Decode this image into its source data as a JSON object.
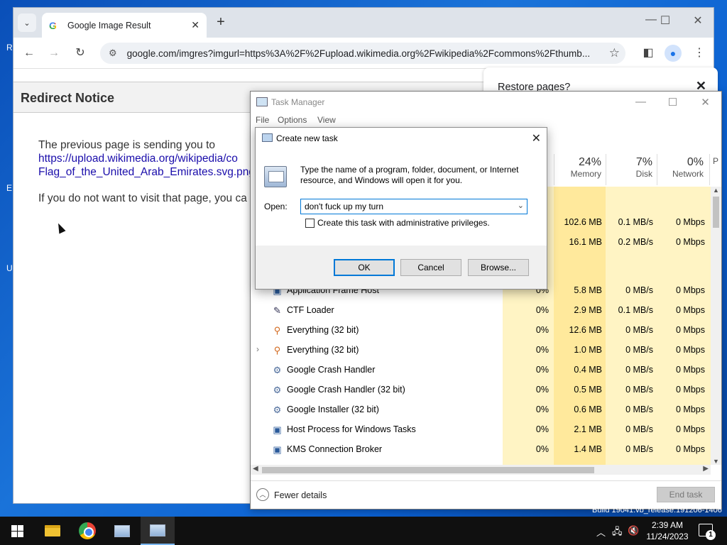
{
  "desktop": {
    "glyphs": [
      "R",
      "E",
      "U"
    ]
  },
  "chrome": {
    "tab_title": "Google Image Result",
    "url": "google.com/imgres?imgurl=https%3A%2F%2Fupload.wikimedia.org%2Fwikipedia%2Fcommons%2Fthumb...",
    "restore_text": "Restore pages?",
    "page": {
      "heading": "Redirect Notice",
      "line1": "The previous page is sending you to",
      "link1": "https://upload.wikimedia.org/wikipedia/co",
      "link2": "Flag_of_the_United_Arab_Emirates.svg.png",
      "line2": "If you do not want to visit that page, you ca"
    }
  },
  "task_manager": {
    "title": "Task Manager",
    "menu": [
      "File",
      "Options",
      "View"
    ],
    "columns": [
      {
        "pct": "24%",
        "label": "Memory"
      },
      {
        "pct": "7%",
        "label": "Disk"
      },
      {
        "pct": "0%",
        "label": "Network"
      }
    ],
    "partial_col": "P",
    "top_rows": [
      {
        "mem": "102.6 MB",
        "disk": "0.1 MB/s",
        "net": "0 Mbps"
      },
      {
        "mem": "16.1 MB",
        "disk": "0.2 MB/s",
        "net": "0 Mbps"
      }
    ],
    "rows": [
      {
        "name": "Application Frame Host",
        "cpu": "0%",
        "mem": "5.8 MB",
        "disk": "0 MB/s",
        "net": "0 Mbps",
        "icon": "window-icon"
      },
      {
        "name": "CTF Loader",
        "cpu": "0%",
        "mem": "2.9 MB",
        "disk": "0.1 MB/s",
        "net": "0 Mbps",
        "icon": "pen-icon"
      },
      {
        "name": "Everything (32 bit)",
        "cpu": "0%",
        "mem": "12.6 MB",
        "disk": "0 MB/s",
        "net": "0 Mbps",
        "icon": "magnifier-icon"
      },
      {
        "name": "Everything (32 bit)",
        "cpu": "0%",
        "mem": "1.0 MB",
        "disk": "0 MB/s",
        "net": "0 Mbps",
        "icon": "magnifier-icon"
      },
      {
        "name": "Google Crash Handler",
        "cpu": "0%",
        "mem": "0.4 MB",
        "disk": "0 MB/s",
        "net": "0 Mbps",
        "icon": "gear-icon"
      },
      {
        "name": "Google Crash Handler (32 bit)",
        "cpu": "0%",
        "mem": "0.5 MB",
        "disk": "0 MB/s",
        "net": "0 Mbps",
        "icon": "gear-icon"
      },
      {
        "name": "Google Installer (32 bit)",
        "cpu": "0%",
        "mem": "0.6 MB",
        "disk": "0 MB/s",
        "net": "0 Mbps",
        "icon": "gear-icon"
      },
      {
        "name": "Host Process for Windows Tasks",
        "cpu": "0%",
        "mem": "2.1 MB",
        "disk": "0 MB/s",
        "net": "0 Mbps",
        "icon": "window-icon"
      },
      {
        "name": "KMS Connection Broker",
        "cpu": "0%",
        "mem": "1.4 MB",
        "disk": "0 MB/s",
        "net": "0 Mbps",
        "icon": "window-icon"
      }
    ],
    "fewer_details": "Fewer details",
    "end_task": "End task"
  },
  "dialog": {
    "title": "Create new task",
    "prompt": "Type the name of a program, folder, document, or Internet resource, and Windows will open it for you.",
    "open_label": "Open:",
    "open_value": "don't fuck up my turn",
    "admin_label": "Create this task with administrative privileges.",
    "ok": "OK",
    "cancel": "Cancel",
    "browse": "Browse..."
  },
  "taskbar": {
    "build_text": "Build 19041.vb_release.191206-1406",
    "time": "2:39 AM",
    "date": "11/24/2023",
    "notif_count": "1"
  },
  "colors": {
    "usage_light": "#fff4c4",
    "usage_mid": "#ffe99c",
    "accent": "#0078d7"
  }
}
